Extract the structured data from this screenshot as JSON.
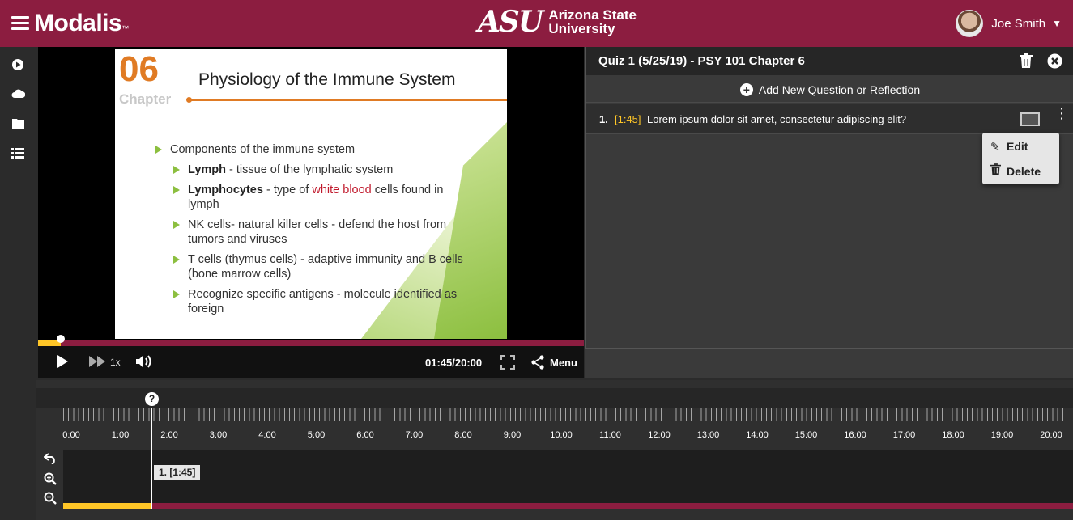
{
  "header": {
    "brand": "Modalis",
    "brand_tm": "™",
    "university_mark": "ASU",
    "university_name_1": "Arizona State",
    "university_name_2": "University",
    "user_name": "Joe Smith"
  },
  "icons": {
    "menu": "hamburger-icon",
    "play_rail": "play-circle-icon",
    "cloud": "cloud-icon",
    "folder": "folder-icon",
    "list": "list-icon"
  },
  "slide": {
    "number": "06",
    "chapter": "Chapter",
    "title": "Physiology of the Immune System",
    "bullet_1": "Components of the immune system",
    "sub_1_bold": "Lymph",
    "sub_1_rest": " - tissue of the lymphatic system",
    "sub_2_bold": "Lymphocytes",
    "sub_2_pre": " - type of ",
    "sub_2_hl": "white blood",
    "sub_2_post": " cells found in lymph",
    "sub_3": "NK cells- natural killer cells - defend the host from tumors and viruses",
    "sub_4": "T cells (thymus cells) - adaptive immunity and B cells (bone marrow cells)",
    "sub_5": "Recognize specific antigens - molecule identified as foreign"
  },
  "player": {
    "speed": "1x",
    "time": "01:45/20:00",
    "menu_label": "Menu",
    "progress_fraction": 0.0875
  },
  "quiz": {
    "title": "Quiz 1 (5/25/19) - PSY 101 Chapter 6",
    "add_label": "Add New Question or Reflection",
    "questions": [
      {
        "number": "1.",
        "time": "[1:45]",
        "text": "Lorem ipsum dolor sit amet, consectetur adipiscing elit?"
      }
    ],
    "menu_edit": "Edit",
    "menu_delete": "Delete"
  },
  "timeline": {
    "labels": [
      "0:00",
      "1:00",
      "2:00",
      "3:00",
      "4:00",
      "5:00",
      "6:00",
      "7:00",
      "8:00",
      "9:00",
      "10:00",
      "11:00",
      "12:00",
      "13:00",
      "14:00",
      "15:00",
      "16:00",
      "17:00",
      "18:00",
      "19:00",
      "20:00"
    ],
    "marker_symbol": "?",
    "marker_tag": "1. [1:45]"
  }
}
